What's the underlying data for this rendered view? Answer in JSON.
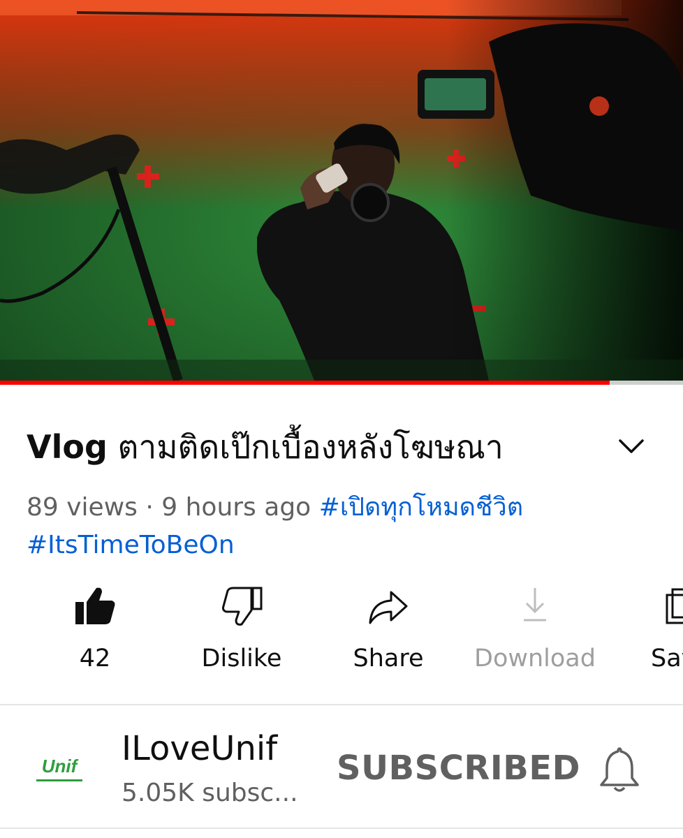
{
  "player": {
    "progress_fraction": 0.893
  },
  "video": {
    "title_prefix": "Vlog",
    "title_rest": "ตามติดเป๊กเบื้องหลังโฆษณา",
    "views": "89 views",
    "separator": " · ",
    "age": "9 hours ago",
    "hashtags": [
      "#เปิดทุกโหมดชีวิต",
      "#ItsTimeToBeOn"
    ]
  },
  "actions": {
    "like_count": "42",
    "dislike_label": "Dislike",
    "share_label": "Share",
    "download_label": "Download",
    "save_label": "Save"
  },
  "channel": {
    "name": "ILoveUnif",
    "subscribers": "5.05K subsc...",
    "logo_text": "Unif",
    "subscribe_state": "SUBSCRIBED"
  },
  "colors": {
    "progress": "#ff0000",
    "hashtag": "#065fd4",
    "meta_text": "#606060",
    "logo_green": "#2e9e3e"
  },
  "icons": [
    "like-filled-icon",
    "dislike-icon",
    "share-icon",
    "download-icon",
    "save-playlist-icon",
    "chevron-down-icon",
    "bell-icon"
  ]
}
